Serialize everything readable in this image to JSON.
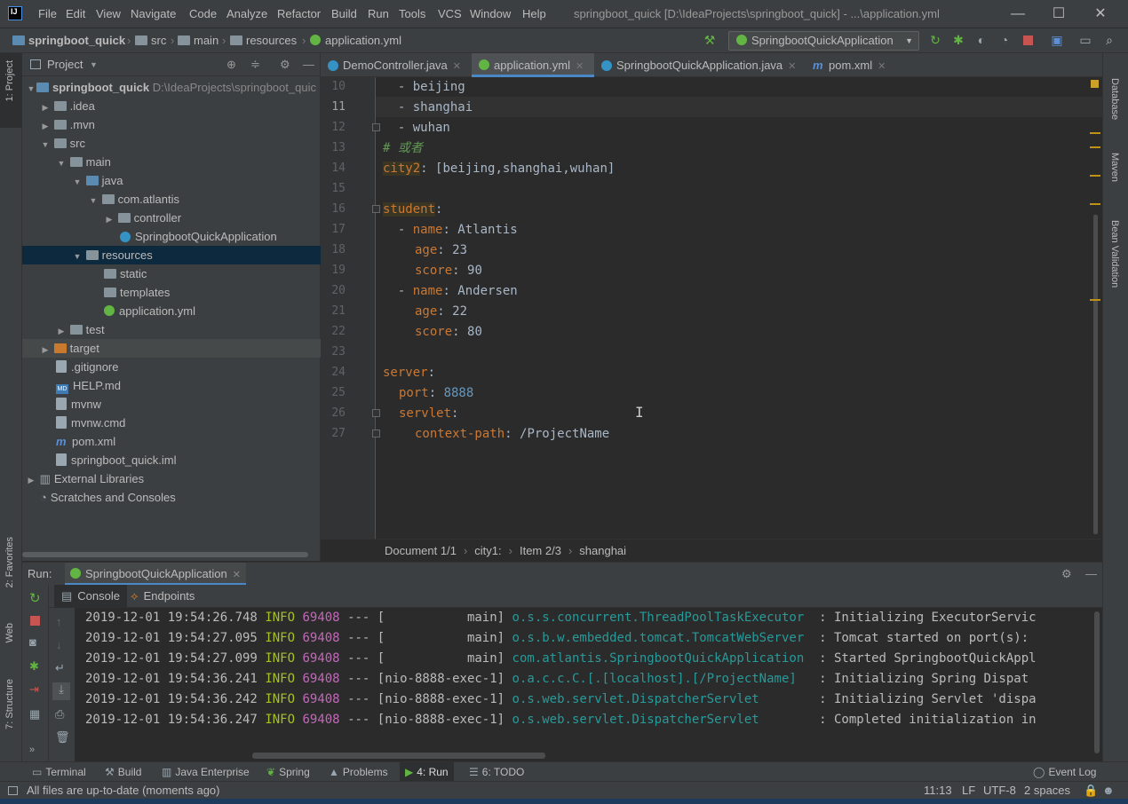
{
  "window": {
    "title": "springboot_quick [D:\\IdeaProjects\\springboot_quick] - ...\\application.yml",
    "logo": "IJ",
    "minimize": "—",
    "maximize": "☐",
    "close": "✕"
  },
  "menu": [
    "File",
    "Edit",
    "View",
    "Navigate",
    "Code",
    "Analyze",
    "Refactor",
    "Build",
    "Run",
    "Tools",
    "VCS",
    "Window",
    "Help"
  ],
  "breadcrumb": [
    "springboot_quick",
    "src",
    "main",
    "resources",
    "application.yml"
  ],
  "run_config": "SpringbootQuickApplication",
  "left_strip": {
    "project": "1: Project",
    "favorites": "2: Favorites",
    "web": "Web",
    "structure": "7: Structure"
  },
  "right_strip": {
    "database": "Database",
    "maven": "Maven",
    "bean": "Bean Validation"
  },
  "project_panel": {
    "title": "Project",
    "root_name": "springboot_quick",
    "root_path": "D:\\IdeaProjects\\springboot_quic",
    "items": [
      ".idea",
      ".mvn",
      "src",
      "main",
      "java",
      "com.atlantis",
      "controller",
      "SpringbootQuickApplication",
      "resources",
      "static",
      "templates",
      "application.yml",
      "test",
      "target",
      ".gitignore",
      "HELP.md",
      "mvnw",
      "mvnw.cmd",
      "pom.xml",
      "springboot_quick.iml",
      "External Libraries",
      "Scratches and Consoles"
    ]
  },
  "tabs": [
    "DemoController.java",
    "application.yml",
    "SpringbootQuickApplication.java",
    "pom.xml"
  ],
  "editor": {
    "line_numbers": [
      "10",
      "11",
      "12",
      "13",
      "14",
      "15",
      "16",
      "17",
      "18",
      "19",
      "20",
      "21",
      "22",
      "23",
      "24",
      "25",
      "26",
      "27"
    ],
    "lines": {
      "l10_dash": "  - ",
      "l10_val": "beijing",
      "l11_dash": "  - ",
      "l11_val": "shanghai",
      "l12_dash": "  - ",
      "l12_val": "wuhan",
      "l13": "# 或者",
      "l14_key": "city2",
      "l14_rest": ": [beijing,shanghai,wuhan]",
      "l16_key": "student",
      "l16_colon": ":",
      "l17_dash": "  - ",
      "l17_key": "name",
      "l17_rest": ": Atlantis",
      "l18_key": "age",
      "l18_rest": ": 23",
      "l19_key": "score",
      "l19_rest": ": 90",
      "l20_dash": "  - ",
      "l20_key": "name",
      "l20_rest": ": Andersen",
      "l21_key": "age",
      "l21_rest": ": 22",
      "l22_key": "score",
      "l22_rest": ": 80",
      "l24_key": "server",
      "l24_colon": ":",
      "l25_key": "port",
      "l25_colon": ": ",
      "l25_val": "8888",
      "l26_key": "servlet",
      "l26_colon": ":",
      "l27_key": "context-path",
      "l27_rest": ": /ProjectName"
    }
  },
  "editor_breadcrumb": [
    "Document 1/1",
    "city1:",
    "Item 2/3",
    "shanghai"
  ],
  "run_panel": {
    "label": "Run:",
    "app_tab": "SpringbootQuickApplication",
    "console_tab": "Console",
    "endpoints_tab": "Endpoints"
  },
  "console_lines": [
    {
      "ts": "2019-12-01 19:54:26.748",
      "level": "INFO",
      "pid": "69408",
      "sep": "---",
      "thread": "[           main]",
      "logger": "o.s.s.concurrent.ThreadPoolTaskExecutor ",
      "msg": " : Initializing ExecutorServic"
    },
    {
      "ts": "2019-12-01 19:54:27.095",
      "level": "INFO",
      "pid": "69408",
      "sep": "---",
      "thread": "[           main]",
      "logger": "o.s.b.w.embedded.tomcat.TomcatWebServer ",
      "msg": " : Tomcat started on port(s):"
    },
    {
      "ts": "2019-12-01 19:54:27.099",
      "level": "INFO",
      "pid": "69408",
      "sep": "---",
      "thread": "[           main]",
      "logger": "com.atlantis.SpringbootQuickApplication ",
      "msg": " : Started SpringbootQuickAppl"
    },
    {
      "ts": "2019-12-01 19:54:36.241",
      "level": "INFO",
      "pid": "69408",
      "sep": "---",
      "thread": "[nio-8888-exec-1]",
      "logger": "o.a.c.c.C.[.[localhost].[/ProjectName]  ",
      "msg": " : Initializing Spring Dispat"
    },
    {
      "ts": "2019-12-01 19:54:36.242",
      "level": "INFO",
      "pid": "69408",
      "sep": "---",
      "thread": "[nio-8888-exec-1]",
      "logger": "o.s.web.servlet.DispatcherServlet       ",
      "msg": " : Initializing Servlet 'dispa"
    },
    {
      "ts": "2019-12-01 19:54:36.247",
      "level": "INFO",
      "pid": "69408",
      "sep": "---",
      "thread": "[nio-8888-exec-1]",
      "logger": "o.s.web.servlet.DispatcherServlet       ",
      "msg": " : Completed initialization in"
    }
  ],
  "bottom_tabs": [
    "Terminal",
    "Build",
    "Java Enterprise",
    "Spring",
    "Problems",
    "4: Run",
    "6: TODO"
  ],
  "event_log": "Event Log",
  "status": {
    "message": "All files are up-to-date (moments ago)",
    "position": "11:13",
    "line_sep": "LF",
    "encoding": "UTF-8",
    "indent": "2 spaces"
  }
}
